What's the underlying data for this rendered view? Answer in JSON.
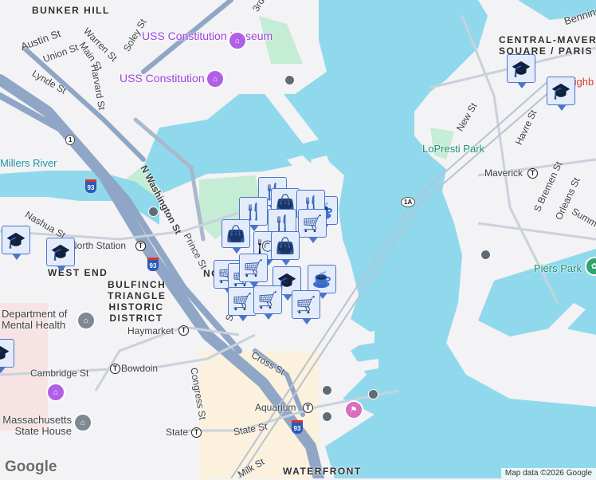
{
  "map": {
    "neighborhoods": [
      "BUNKER HILL",
      "WEST END",
      "BULFINCH TRIANGLE HISTORIC DISTRICT",
      "CENTRAL-MAVERICK SQUARE / PARIS",
      "WATERFRONT",
      "NO"
    ],
    "streets": [
      "Austin St",
      "Union St",
      "Warren St",
      "Main St",
      "Soley St",
      "Harvard St",
      "Lynde St",
      "N Washington St",
      "Nashua St",
      "Prince St",
      "Congress St",
      "Cross St",
      "Cambridge St",
      "State St",
      "Milk St",
      "New St",
      "Havre St",
      "S Bremen St",
      "Orleans St",
      "Summ",
      "Benning",
      "3rd",
      "Sa"
    ],
    "pois": [
      "USS Constitution Museum",
      "USS Constitution",
      "Department of Mental Health",
      "Massachusetts State House"
    ],
    "parks": [
      "LoPresti Park",
      "Piers Park"
    ],
    "water": [
      "Millers River"
    ],
    "stations": [
      "North Station",
      "Haymarket",
      "Bowdoin",
      "State",
      "Aquarium",
      "Maverick"
    ],
    "highways": [
      "1",
      "93",
      "1A"
    ],
    "partial_label": "Neighb",
    "markers": [
      "school",
      "school",
      "school",
      "school",
      "school",
      "fork",
      "bag",
      "fork",
      "cup",
      "fork",
      "bag",
      "fork",
      "cart",
      "restaurant",
      "bag",
      "cart",
      "cart",
      "school",
      "cup",
      "cart",
      "cart",
      "cart",
      "cart"
    ],
    "attribution": "Map data ©2026 Google",
    "logo": "Google"
  },
  "colors": {
    "water": "#90d9ec",
    "land": "#f3f2f4",
    "park": "#c5ecd5",
    "highway": "#8fa6c6",
    "marker_border": "#4a76c9",
    "marker_icon": "#0d3b66",
    "poi": "#9b42e0"
  }
}
